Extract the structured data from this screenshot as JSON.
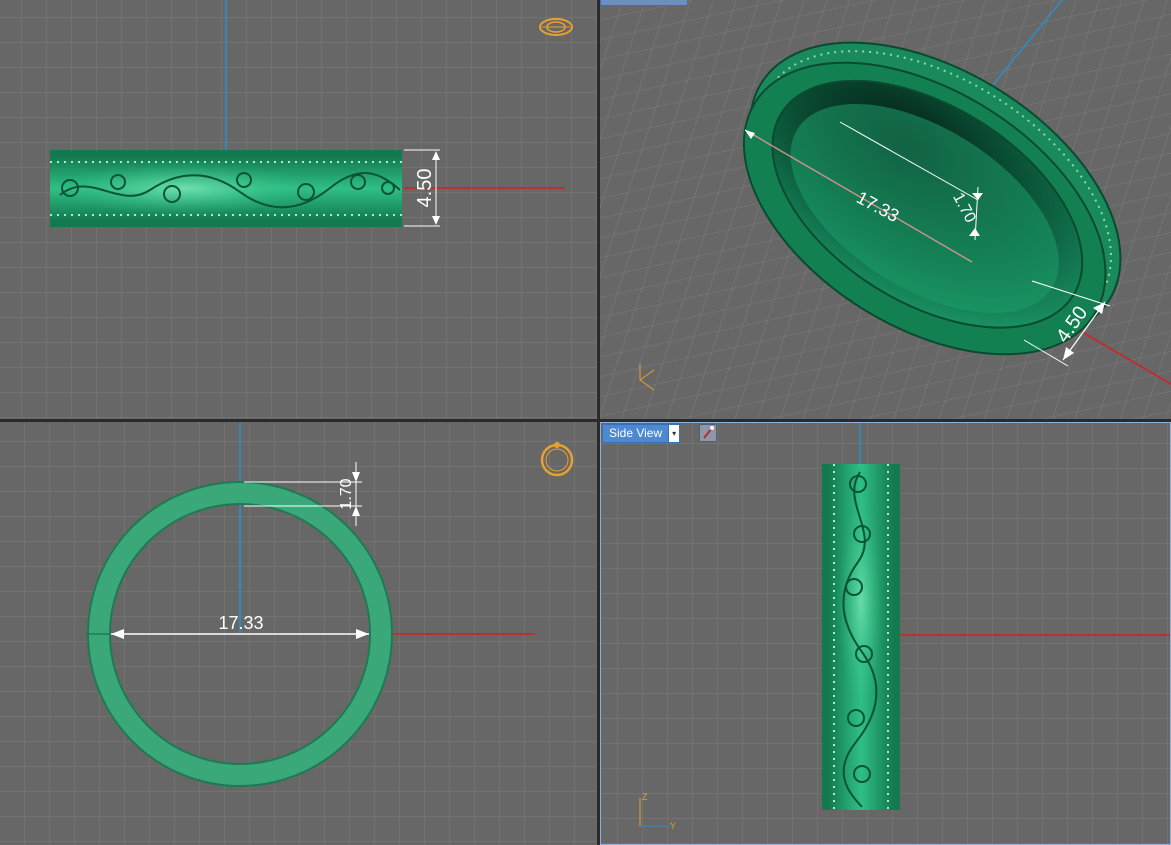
{
  "viewports": {
    "top": {
      "dimension_height": "4.50"
    },
    "perspective": {
      "dimension_diameter": "17.33",
      "dimension_thickness": "1.70",
      "dimension_height": "4.50"
    },
    "front": {
      "dimension_diameter": "17.33",
      "dimension_thickness": "1.70"
    },
    "side": {
      "view_label": "Side View",
      "view_dropdown_arrow": "▾",
      "axis_z": "Z",
      "axis_y": "Y"
    }
  },
  "colors": {
    "grid_background": "#676767",
    "grid_line": "#7c7c7c",
    "ring_green": "#1f9a67",
    "ring_dark": "#0c5a3a",
    "axis_red": "#d42020",
    "axis_blue": "#2a8fc8",
    "gizmo_orange": "#e8a030",
    "active_view_blue": "#4d88d0"
  },
  "icons": [
    "ring-navigation-gizmo-icon",
    "axis-triad-icon",
    "paint-tool-icon",
    "dropdown-arrow-icon"
  ]
}
